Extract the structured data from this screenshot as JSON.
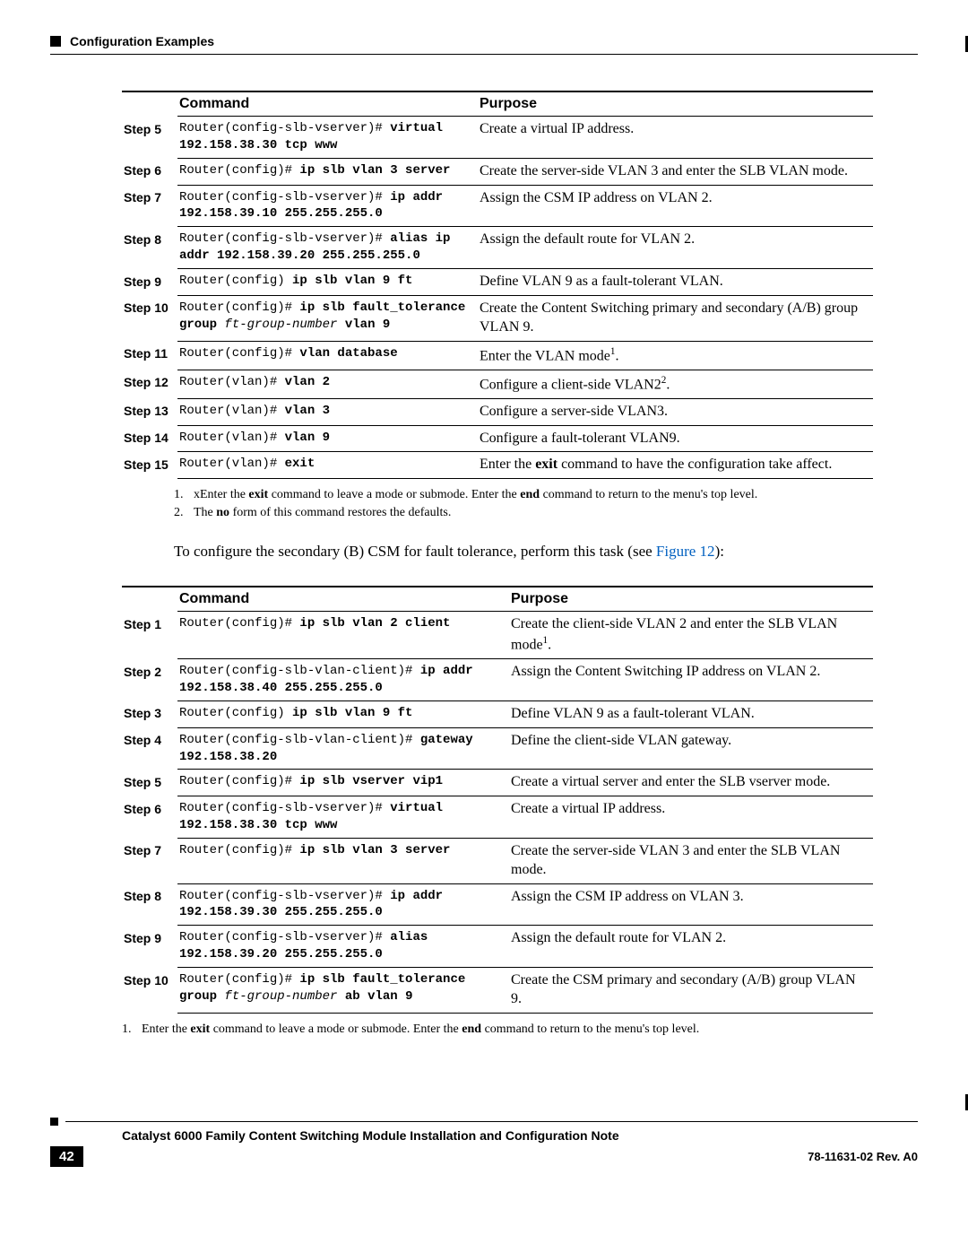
{
  "header": {
    "section": "Configuration Examples"
  },
  "table1": {
    "headers": {
      "command": "Command",
      "purpose": "Purpose"
    },
    "rows": [
      {
        "step": "Step 5",
        "cmd_html": "Router(config-slb-vserver)# <b>virtual 192.158.38.30 tcp www</b>",
        "purpose_html": "Create a virtual IP address."
      },
      {
        "step": "Step 6",
        "cmd_html": "Router(config)# <b>ip slb vlan 3 server</b>",
        "purpose_html": "Create the server-side VLAN 3 and enter the SLB VLAN mode."
      },
      {
        "step": "Step 7",
        "cmd_html": "Router(config-slb-vserver)# <b>ip addr 192.158.39.10 255.255.255.0</b>",
        "purpose_html": "Assign the CSM IP address on VLAN 2."
      },
      {
        "step": "Step 8",
        "cmd_html": "Router(config-slb-vserver)# <b>alias ip addr 192.158.39.20 255.255.255.0</b>",
        "purpose_html": "Assign the default route for VLAN 2."
      },
      {
        "step": "Step 9",
        "cmd_html": "Router(config) <b>ip slb vlan 9 ft</b>",
        "purpose_html": "Define VLAN 9 as a fault-tolerant VLAN."
      },
      {
        "step": "Step 10",
        "cmd_html": "Router(config)# <b>ip slb fault_tolerance group</b> <i>ft-group-number</i> <b>vlan 9</b>",
        "purpose_html": "Create the Content Switching primary and secondary (A/B) group VLAN 9."
      },
      {
        "step": "Step 11",
        "cmd_html": "Router(config)# <b>vlan database</b>",
        "purpose_html": "Enter the VLAN mode<sup>1</sup>."
      },
      {
        "step": "Step 12",
        "cmd_html": "Router(vlan)# <b>vlan 2</b>",
        "purpose_html": "Configure a client-side VLAN2<sup>2</sup>."
      },
      {
        "step": "Step 13",
        "cmd_html": "Router(vlan)# <b>vlan 3</b>",
        "purpose_html": "Configure a server-side VLAN3."
      },
      {
        "step": "Step 14",
        "cmd_html": "Router(vlan)# <b>vlan 9</b>",
        "purpose_html": "Configure a fault-tolerant VLAN9."
      },
      {
        "step": "Step 15",
        "cmd_html": "Router(vlan)# <b>exit</b>",
        "purpose_html": "Enter the <b>exit</b> command to have the configuration take affect."
      }
    ],
    "footnotes": [
      {
        "num": "1.",
        "html": "xEnter the <b>exit</b> command to leave a mode or submode. Enter the <b>end</b> command to return to the menu's  top level."
      },
      {
        "num": "2.",
        "html": "The <b>no</b> form of this command restores the defaults."
      }
    ]
  },
  "paragraph": {
    "text_pre": "To configure the secondary (B) CSM for fault tolerance, perform this task (see ",
    "link": "Figure 12",
    "text_post": "):"
  },
  "table2": {
    "headers": {
      "command": "Command",
      "purpose": "Purpose"
    },
    "rows": [
      {
        "step": "Step 1",
        "cmd_html": "Router(config)# <b>ip slb vlan 2 client</b>",
        "purpose_html": "Create the client-side VLAN 2 and enter the SLB VLAN mode<sup>1</sup>."
      },
      {
        "step": "Step 2",
        "cmd_html": "Router(config-slb-vlan-client)# <b>ip addr 192.158.38.40 255.255.255.0</b>",
        "purpose_html": "Assign the Content Switching IP address on VLAN 2."
      },
      {
        "step": "Step 3",
        "cmd_html": "Router(config) <b>ip slb vlan 9 ft</b>",
        "purpose_html": "Define VLAN 9 as a fault-tolerant VLAN."
      },
      {
        "step": "Step 4",
        "cmd_html": "Router(config-slb-vlan-client)# <b>gateway 192.158.38.20</b>",
        "purpose_html": "Define the client-side VLAN gateway."
      },
      {
        "step": "Step 5",
        "cmd_html": "Router(config)# <b>ip slb vserver vip1</b>",
        "purpose_html": "Create a virtual server and enter the SLB vserver mode."
      },
      {
        "step": "Step 6",
        "cmd_html": "Router(config-slb-vserver)# <b>virtual 192.158.38.30 tcp www</b>",
        "purpose_html": "Create a virtual IP address."
      },
      {
        "step": "Step 7",
        "cmd_html": "Router(config)# <b>ip slb vlan 3 server</b>",
        "purpose_html": "Create the server-side VLAN 3 and enter the SLB VLAN mode."
      },
      {
        "step": "Step 8",
        "cmd_html": "Router(config-slb-vserver)# <b>ip addr 192.158.39.30 255.255.255.0</b>",
        "purpose_html": "Assign the CSM IP address on VLAN 3."
      },
      {
        "step": "Step 9",
        "cmd_html": "Router(config-slb-vserver)# <b>alias 192.158.39.20 255.255.255.0</b>",
        "purpose_html": "Assign the default route for VLAN 2."
      },
      {
        "step": "Step 10",
        "cmd_html": "Router(config)# <b>ip slb fault_tolerance group</b> <i>ft-group-number</i> <b>ab vlan 9</b>",
        "purpose_html": "Create the CSM primary and secondary (A/B) group VLAN 9."
      }
    ],
    "footnotes": [
      {
        "num": "1.",
        "html": "Enter the <b>exit</b> command to leave a mode or submode. Enter the <b>end</b> command to return to the menu's  top level."
      }
    ]
  },
  "footer": {
    "title": "Catalyst 6000 Family Content Switching Module Installation and Configuration Note",
    "page": "42",
    "rev": "78-11631-02 Rev. A0"
  }
}
